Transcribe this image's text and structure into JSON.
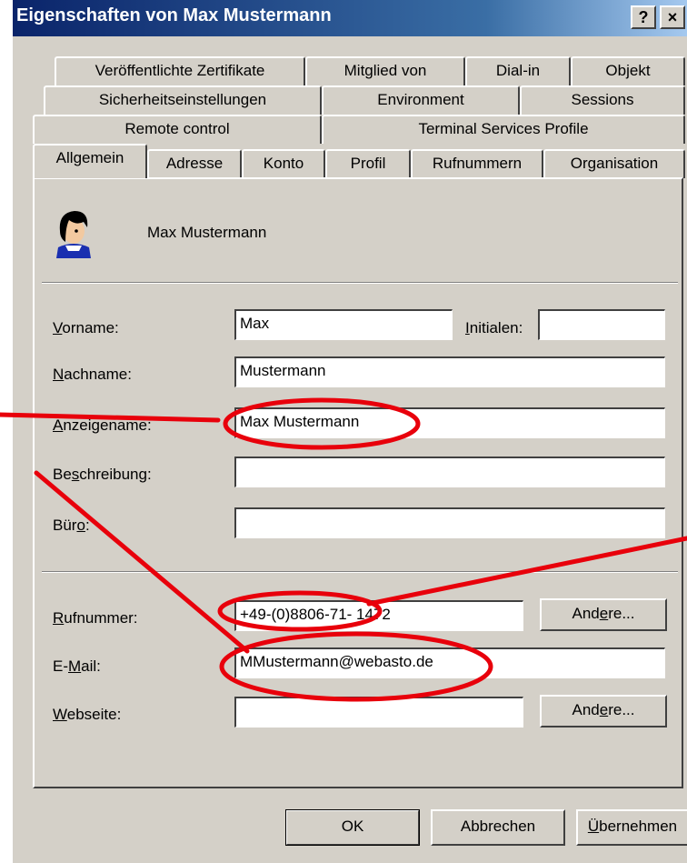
{
  "window": {
    "title": "Eigenschaften von Max Mustermann",
    "help_btn": "?",
    "close_btn": "×"
  },
  "tabs": {
    "row1": [
      "Veröffentlichte Zertifikate",
      "Mitglied von",
      "Dial-in",
      "Objekt"
    ],
    "row2": [
      "Sicherheitseinstellungen",
      "Environment",
      "Sessions"
    ],
    "row3": [
      "Remote control",
      "Terminal Services Profile"
    ],
    "row4": [
      "Allgemein",
      "Adresse",
      "Konto",
      "Profil",
      "Rufnummern",
      "Organisation"
    ],
    "active": "Allgemein"
  },
  "header": {
    "display_name": "Max Mustermann",
    "icon": "user-icon"
  },
  "form": {
    "vorname": {
      "mnemonic": "V",
      "rest": "orname:",
      "value": "Max"
    },
    "initialen": {
      "mnemonic": "I",
      "rest": "nitialen:",
      "value": ""
    },
    "nachname": {
      "mnemonic": "N",
      "rest": "achname:",
      "value": "Mustermann"
    },
    "anzeigename": {
      "mnemonic": "A",
      "rest": "nzeigename:",
      "value": "Max Mustermann"
    },
    "beschreibung": {
      "pre": "Be",
      "mnemonic": "s",
      "rest": "chreibung:",
      "value": ""
    },
    "buero": {
      "pre": "Bür",
      "mnemonic": "o",
      "rest": ":",
      "value": ""
    },
    "rufnummer": {
      "mnemonic": "R",
      "rest": "ufnummer:",
      "value": "+49-(0)8806-71- 1472"
    },
    "email": {
      "pre": "E-",
      "mnemonic": "M",
      "rest": "ail:",
      "value": "MMustermann@webasto.de"
    },
    "webseite": {
      "mnemonic": "W",
      "rest": "ebseite:",
      "value": ""
    },
    "andere_phone": {
      "pre": "And",
      "mnemonic": "e",
      "rest": "re..."
    },
    "andere_web": {
      "pre": "And",
      "mnemonic": "e",
      "rest": "re..."
    }
  },
  "buttons": {
    "ok": "OK",
    "cancel": "Abbrechen",
    "apply": {
      "mnemonic": "Ü",
      "rest": "bernehmen"
    }
  },
  "colors": {
    "annotation": "#e8000b",
    "title_start": "#0a246a",
    "title_end": "#a6caf0",
    "face": "#d4d0c8"
  }
}
